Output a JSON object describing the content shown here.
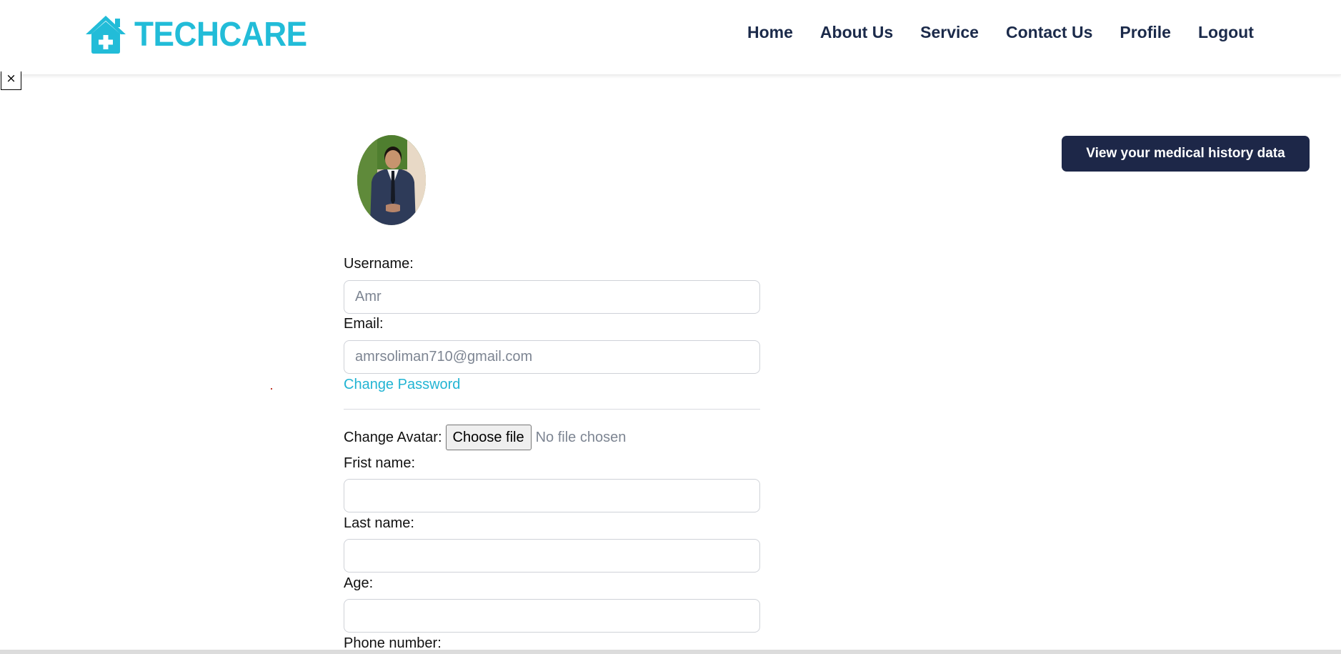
{
  "brand": {
    "name": "TECHCARE",
    "color": "#22bcd8",
    "icon": "house-medical-icon"
  },
  "nav": {
    "items": [
      "Home",
      "About Us",
      "Service",
      "Contact Us",
      "Profile",
      "Logout"
    ],
    "color": "#1b2a4a"
  },
  "close": {
    "label": "×",
    "icon": "close-icon"
  },
  "history_button": {
    "label": "View your medical history data",
    "color": "#1d2748"
  },
  "profile": {
    "avatar_icon": "avatar-photo",
    "username": {
      "label": "Username:",
      "placeholder": "Amr",
      "value": ""
    },
    "email": {
      "label": "Email:",
      "placeholder": "amrsoliman710@gmail.com",
      "value": ""
    },
    "change_password": {
      "label": "Change Password",
      "color": "#22b4d3"
    },
    "change_avatar": {
      "label": "Change Avatar:",
      "button": "Choose file",
      "status": "No file chosen"
    },
    "first_name": {
      "label": "Frist name:",
      "value": ""
    },
    "last_name": {
      "label": "Last name:",
      "value": ""
    },
    "age": {
      "label": "Age:",
      "value": ""
    },
    "phone": {
      "label": "Phone number:"
    }
  }
}
